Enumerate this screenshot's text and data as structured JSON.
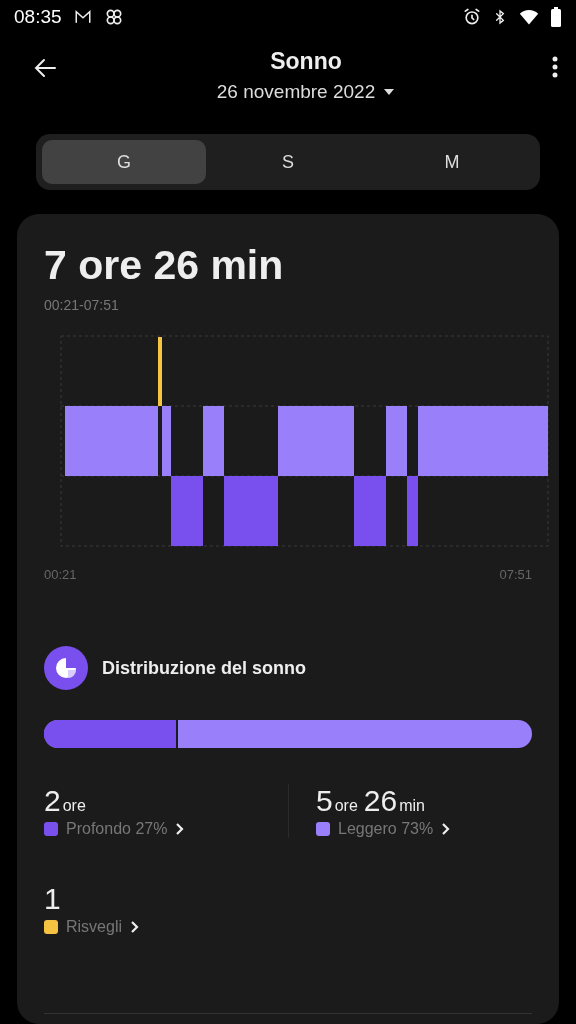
{
  "status_bar": {
    "time": "08:35"
  },
  "header": {
    "title": "Sonno",
    "date": "26 novembre 2022"
  },
  "tabs": [
    {
      "label": "G",
      "selected": true
    },
    {
      "label": "S",
      "selected": false
    },
    {
      "label": "M",
      "selected": false
    }
  ],
  "summary": {
    "duration": "7 ore 26 min",
    "range": "00:21-07:51",
    "axis_start": "00:21",
    "axis_end": "07:51"
  },
  "distribution": {
    "title": "Distribuzione del sonno",
    "level": 0.27,
    "stats": [
      {
        "parts": [
          {
            "num": "2",
            "unit": "ore"
          }
        ],
        "label": "Profondo 27%",
        "color": "#7950ee"
      },
      {
        "parts": [
          {
            "num": "5",
            "unit": "ore"
          },
          {
            "num": "26",
            "unit": "min"
          }
        ],
        "label": "Leggero 73%",
        "color": "#9a7ffb"
      }
    ],
    "wakeups": {
      "parts": [
        {
          "num": "1"
        }
      ],
      "label": "Risvegli",
      "color": "#f5c242"
    }
  }
}
